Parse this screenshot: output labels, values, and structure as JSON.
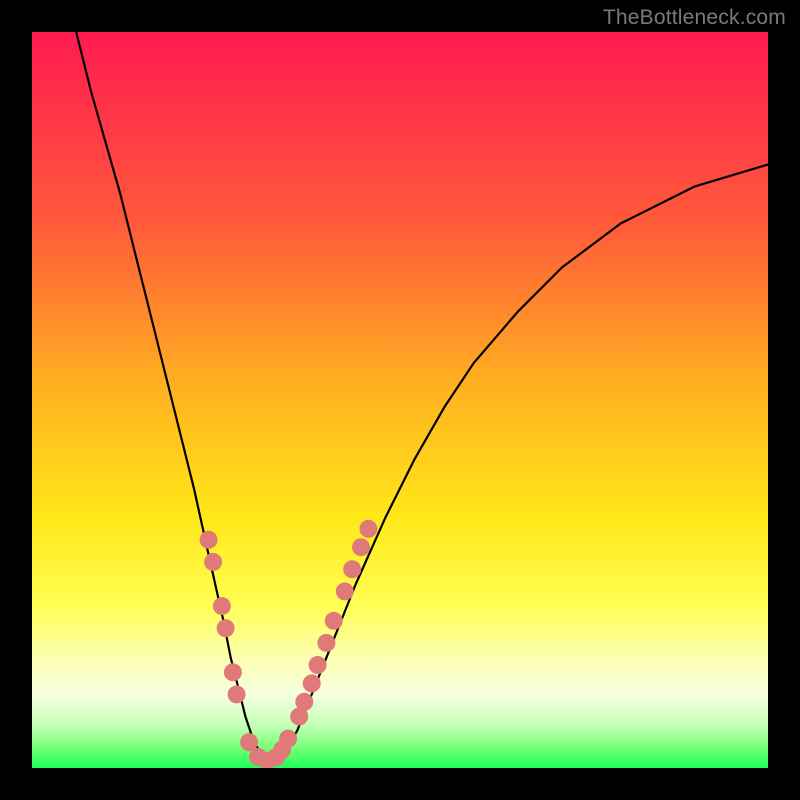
{
  "watermark": "TheBottleneck.com",
  "colors": {
    "bg_black": "#000000",
    "gradient_top": "#ff1a52",
    "gradient_mid1": "#ff7a2b",
    "gradient_mid2": "#ffd31a",
    "gradient_mid3": "#ffff66",
    "gradient_bottom": "#1cff5a",
    "curve": "#000000",
    "dot_fill": "#e07a7a",
    "dot_stroke": "#c75c5c"
  },
  "chart_data": {
    "type": "line",
    "title": "",
    "xlabel": "",
    "ylabel": "",
    "xlim": [
      0,
      100
    ],
    "ylim": [
      0,
      100
    ],
    "series": [
      {
        "name": "bottleneck-curve",
        "x": [
          6,
          8,
          10,
          12,
          14,
          16,
          18,
          20,
          22,
          24,
          26,
          27,
          28,
          29,
          30,
          31,
          32,
          33,
          34,
          36,
          38,
          40,
          44,
          48,
          52,
          56,
          60,
          66,
          72,
          80,
          90,
          100
        ],
        "y": [
          100,
          92,
          85,
          78,
          70,
          62,
          54,
          46,
          38,
          29,
          20,
          15,
          11,
          7,
          4,
          2,
          1,
          1,
          2,
          5,
          10,
          15,
          25,
          34,
          42,
          49,
          55,
          62,
          68,
          74,
          79,
          82
        ]
      }
    ],
    "dots": {
      "name": "highlighted-points",
      "points": [
        {
          "x": 24.0,
          "y": 31
        },
        {
          "x": 24.6,
          "y": 28
        },
        {
          "x": 25.8,
          "y": 22
        },
        {
          "x": 26.3,
          "y": 19
        },
        {
          "x": 27.3,
          "y": 13
        },
        {
          "x": 27.8,
          "y": 10
        },
        {
          "x": 29.5,
          "y": 3.5
        },
        {
          "x": 30.7,
          "y": 1.5
        },
        {
          "x": 32.0,
          "y": 1.0
        },
        {
          "x": 33.2,
          "y": 1.5
        },
        {
          "x": 34.0,
          "y": 2.5
        },
        {
          "x": 34.8,
          "y": 4.0
        },
        {
          "x": 36.3,
          "y": 7.0
        },
        {
          "x": 37.0,
          "y": 9.0
        },
        {
          "x": 38.0,
          "y": 11.5
        },
        {
          "x": 38.8,
          "y": 14.0
        },
        {
          "x": 40.0,
          "y": 17.0
        },
        {
          "x": 41.0,
          "y": 20.0
        },
        {
          "x": 42.5,
          "y": 24.0
        },
        {
          "x": 43.5,
          "y": 27.0
        },
        {
          "x": 44.7,
          "y": 30.0
        },
        {
          "x": 45.7,
          "y": 32.5
        }
      ]
    }
  }
}
